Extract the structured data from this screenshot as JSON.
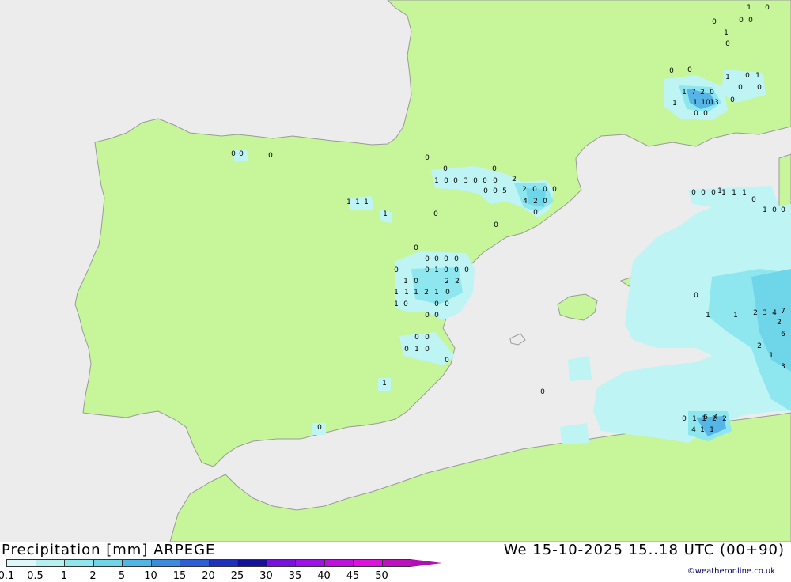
{
  "title_left": "Precipitation [mm] ARPEGE",
  "title_right": "We 15-10-2025 15..18 UTC (00+90)",
  "credit": "©weatheronline.co.uk",
  "colors": {
    "sea": "#ececec",
    "land": "#c6f59a",
    "coast": "#b0b0b0",
    "precip_light": "#bff4f4",
    "precip_mid": "#8ee7ef",
    "precip_heavy": "#55b5e6"
  },
  "legend": {
    "ticks": [
      "0.1",
      "0.5",
      "1",
      "2",
      "5",
      "10",
      "15",
      "20",
      "25",
      "30",
      "35",
      "40",
      "45",
      "50"
    ],
    "colors": [
      "#ddf8f8",
      "#b4f0f0",
      "#8ee7ef",
      "#6fd6ea",
      "#4fb6e6",
      "#3a8ce0",
      "#2c5fd8",
      "#1f30c0",
      "#14109a",
      "#7a10e0",
      "#a010e8",
      "#c010e0",
      "#e010e0",
      "#c010c0"
    ]
  },
  "precip_labels": [
    {
      "group": "northwest",
      "values": [
        "0",
        "0",
        "0"
      ]
    },
    {
      "group": "north",
      "values": [
        "1",
        "1",
        "1",
        "1",
        "0",
        "0"
      ]
    },
    {
      "group": "pyrenees",
      "values": [
        "0",
        "0",
        "0",
        "1",
        "0",
        "0",
        "3",
        "0",
        "0",
        "0",
        "2",
        "0",
        "0",
        "5",
        "2",
        "0",
        "0",
        "0",
        "4",
        "2",
        "0",
        "0"
      ]
    },
    {
      "group": "valencia",
      "values": [
        "0",
        "0",
        "0",
        "0",
        "0",
        "0",
        "0",
        "1",
        "0",
        "0",
        "1",
        "0",
        "2",
        "2",
        "0",
        "1",
        "1",
        "1",
        "2",
        "1",
        "0",
        "1",
        "0",
        "0",
        "0",
        "0",
        "0",
        "0",
        "0",
        "0",
        "1",
        "0",
        "0"
      ]
    },
    {
      "group": "south",
      "values": [
        "1",
        "0",
        "0"
      ]
    },
    {
      "group": "alps",
      "values": [
        "1",
        "0",
        "0",
        "0",
        "0",
        "1",
        "0",
        "0",
        "0",
        "1",
        "7",
        "2",
        "0",
        "1",
        "1",
        "10",
        "13",
        "0",
        "0",
        "0",
        "1",
        "0",
        "1",
        "0",
        "0"
      ]
    },
    {
      "group": "sardinia_sea",
      "values": [
        "0",
        "0",
        "0",
        "1",
        "1",
        "1",
        "0",
        "1",
        "0",
        "0",
        "1"
      ]
    },
    {
      "group": "balearic_east",
      "values": [
        "0",
        "1",
        "1",
        "2",
        "3",
        "4",
        "7",
        "2",
        "2",
        "1",
        "3",
        "6"
      ]
    },
    {
      "group": "algeria",
      "values": [
        "0",
        "1",
        "1",
        "2",
        "2",
        "4",
        "6",
        "4",
        "1",
        "1"
      ]
    }
  ]
}
